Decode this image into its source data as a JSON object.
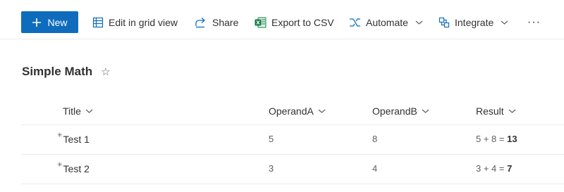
{
  "commandbar": {
    "new_label": "New",
    "edit_grid_label": "Edit in grid view",
    "share_label": "Share",
    "export_label": "Export to CSV",
    "automate_label": "Automate",
    "integrate_label": "Integrate",
    "more_label": "···"
  },
  "list": {
    "title": "Simple Math",
    "favorite_icon": "☆"
  },
  "table": {
    "columns": [
      "Title",
      "OperandA",
      "OperandB",
      "Result"
    ],
    "rows": [
      {
        "title": "Test 1",
        "operand_a": "5",
        "operand_b": "8",
        "result_expr": "5 + 8 = ",
        "result_value": "13"
      },
      {
        "title": "Test 2",
        "operand_a": "3",
        "operand_b": "4",
        "result_expr": "3 + 4 = ",
        "result_value": "7"
      }
    ]
  },
  "colors": {
    "accent": "#0f6cbd",
    "divider": "#edebe9"
  }
}
